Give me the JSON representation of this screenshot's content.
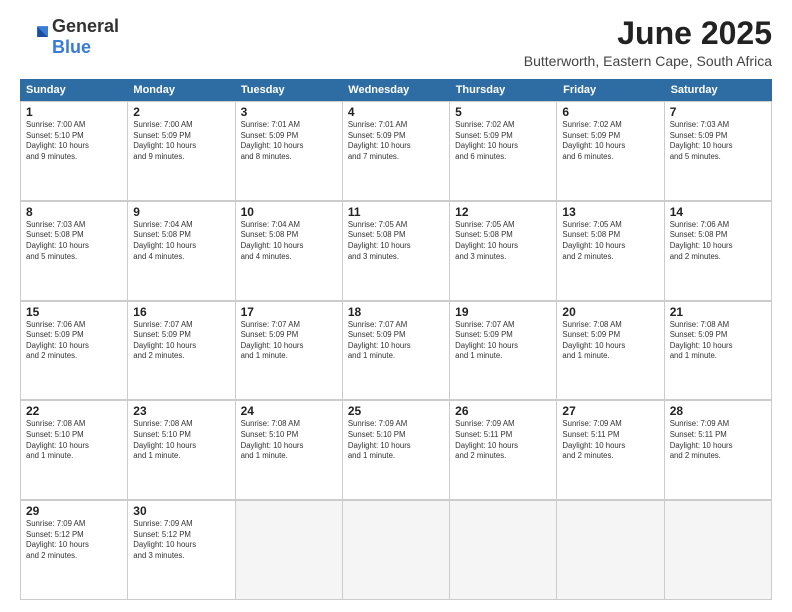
{
  "logo": {
    "general": "General",
    "blue": "Blue"
  },
  "title": "June 2025",
  "location": "Butterworth, Eastern Cape, South Africa",
  "header_days": [
    "Sunday",
    "Monday",
    "Tuesday",
    "Wednesday",
    "Thursday",
    "Friday",
    "Saturday"
  ],
  "weeks": [
    [
      {
        "day": "1",
        "lines": [
          "Sunrise: 7:00 AM",
          "Sunset: 5:10 PM",
          "Daylight: 10 hours",
          "and 9 minutes."
        ]
      },
      {
        "day": "2",
        "lines": [
          "Sunrise: 7:00 AM",
          "Sunset: 5:09 PM",
          "Daylight: 10 hours",
          "and 9 minutes."
        ]
      },
      {
        "day": "3",
        "lines": [
          "Sunrise: 7:01 AM",
          "Sunset: 5:09 PM",
          "Daylight: 10 hours",
          "and 8 minutes."
        ]
      },
      {
        "day": "4",
        "lines": [
          "Sunrise: 7:01 AM",
          "Sunset: 5:09 PM",
          "Daylight: 10 hours",
          "and 7 minutes."
        ]
      },
      {
        "day": "5",
        "lines": [
          "Sunrise: 7:02 AM",
          "Sunset: 5:09 PM",
          "Daylight: 10 hours",
          "and 6 minutes."
        ]
      },
      {
        "day": "6",
        "lines": [
          "Sunrise: 7:02 AM",
          "Sunset: 5:09 PM",
          "Daylight: 10 hours",
          "and 6 minutes."
        ]
      },
      {
        "day": "7",
        "lines": [
          "Sunrise: 7:03 AM",
          "Sunset: 5:09 PM",
          "Daylight: 10 hours",
          "and 5 minutes."
        ]
      }
    ],
    [
      {
        "day": "8",
        "lines": [
          "Sunrise: 7:03 AM",
          "Sunset: 5:08 PM",
          "Daylight: 10 hours",
          "and 5 minutes."
        ]
      },
      {
        "day": "9",
        "lines": [
          "Sunrise: 7:04 AM",
          "Sunset: 5:08 PM",
          "Daylight: 10 hours",
          "and 4 minutes."
        ]
      },
      {
        "day": "10",
        "lines": [
          "Sunrise: 7:04 AM",
          "Sunset: 5:08 PM",
          "Daylight: 10 hours",
          "and 4 minutes."
        ]
      },
      {
        "day": "11",
        "lines": [
          "Sunrise: 7:05 AM",
          "Sunset: 5:08 PM",
          "Daylight: 10 hours",
          "and 3 minutes."
        ]
      },
      {
        "day": "12",
        "lines": [
          "Sunrise: 7:05 AM",
          "Sunset: 5:08 PM",
          "Daylight: 10 hours",
          "and 3 minutes."
        ]
      },
      {
        "day": "13",
        "lines": [
          "Sunrise: 7:05 AM",
          "Sunset: 5:08 PM",
          "Daylight: 10 hours",
          "and 2 minutes."
        ]
      },
      {
        "day": "14",
        "lines": [
          "Sunrise: 7:06 AM",
          "Sunset: 5:08 PM",
          "Daylight: 10 hours",
          "and 2 minutes."
        ]
      }
    ],
    [
      {
        "day": "15",
        "lines": [
          "Sunrise: 7:06 AM",
          "Sunset: 5:09 PM",
          "Daylight: 10 hours",
          "and 2 minutes."
        ]
      },
      {
        "day": "16",
        "lines": [
          "Sunrise: 7:07 AM",
          "Sunset: 5:09 PM",
          "Daylight: 10 hours",
          "and 2 minutes."
        ]
      },
      {
        "day": "17",
        "lines": [
          "Sunrise: 7:07 AM",
          "Sunset: 5:09 PM",
          "Daylight: 10 hours",
          "and 1 minute."
        ]
      },
      {
        "day": "18",
        "lines": [
          "Sunrise: 7:07 AM",
          "Sunset: 5:09 PM",
          "Daylight: 10 hours",
          "and 1 minute."
        ]
      },
      {
        "day": "19",
        "lines": [
          "Sunrise: 7:07 AM",
          "Sunset: 5:09 PM",
          "Daylight: 10 hours",
          "and 1 minute."
        ]
      },
      {
        "day": "20",
        "lines": [
          "Sunrise: 7:08 AM",
          "Sunset: 5:09 PM",
          "Daylight: 10 hours",
          "and 1 minute."
        ]
      },
      {
        "day": "21",
        "lines": [
          "Sunrise: 7:08 AM",
          "Sunset: 5:09 PM",
          "Daylight: 10 hours",
          "and 1 minute."
        ]
      }
    ],
    [
      {
        "day": "22",
        "lines": [
          "Sunrise: 7:08 AM",
          "Sunset: 5:10 PM",
          "Daylight: 10 hours",
          "and 1 minute."
        ]
      },
      {
        "day": "23",
        "lines": [
          "Sunrise: 7:08 AM",
          "Sunset: 5:10 PM",
          "Daylight: 10 hours",
          "and 1 minute."
        ]
      },
      {
        "day": "24",
        "lines": [
          "Sunrise: 7:08 AM",
          "Sunset: 5:10 PM",
          "Daylight: 10 hours",
          "and 1 minute."
        ]
      },
      {
        "day": "25",
        "lines": [
          "Sunrise: 7:09 AM",
          "Sunset: 5:10 PM",
          "Daylight: 10 hours",
          "and 1 minute."
        ]
      },
      {
        "day": "26",
        "lines": [
          "Sunrise: 7:09 AM",
          "Sunset: 5:11 PM",
          "Daylight: 10 hours",
          "and 2 minutes."
        ]
      },
      {
        "day": "27",
        "lines": [
          "Sunrise: 7:09 AM",
          "Sunset: 5:11 PM",
          "Daylight: 10 hours",
          "and 2 minutes."
        ]
      },
      {
        "day": "28",
        "lines": [
          "Sunrise: 7:09 AM",
          "Sunset: 5:11 PM",
          "Daylight: 10 hours",
          "and 2 minutes."
        ]
      }
    ],
    [
      {
        "day": "29",
        "lines": [
          "Sunrise: 7:09 AM",
          "Sunset: 5:12 PM",
          "Daylight: 10 hours",
          "and 2 minutes."
        ]
      },
      {
        "day": "30",
        "lines": [
          "Sunrise: 7:09 AM",
          "Sunset: 5:12 PM",
          "Daylight: 10 hours",
          "and 3 minutes."
        ]
      },
      {
        "day": "",
        "lines": []
      },
      {
        "day": "",
        "lines": []
      },
      {
        "day": "",
        "lines": []
      },
      {
        "day": "",
        "lines": []
      },
      {
        "day": "",
        "lines": []
      }
    ]
  ]
}
